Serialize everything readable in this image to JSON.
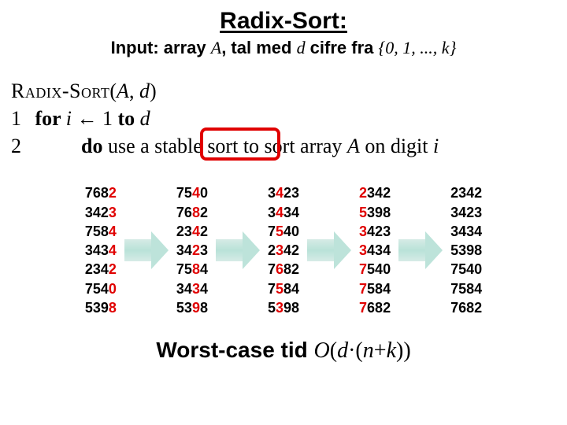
{
  "title": "Radix-Sort:",
  "subtitle": {
    "prefix": "Input: array ",
    "A": "A",
    "mid": ", tal med ",
    "d": "d",
    "suffix": " cifre fra ",
    "set": "{0, 1, ..., k}"
  },
  "pseudocode": {
    "head": {
      "name": "Radix-Sort",
      "args_open": "(",
      "A": "A",
      "comma": ", ",
      "d": "d",
      "args_close": ")"
    },
    "line1": {
      "num": "1",
      "for": "for ",
      "i": "i",
      "arrow": " ← 1 ",
      "to": "to ",
      "d": "d"
    },
    "line2": {
      "num": "2",
      "do": "do ",
      "rest1": "use a stable sort to sort array ",
      "A": "A",
      "rest2": " on digit ",
      "i": "i"
    }
  },
  "passes": [
    {
      "rows": [
        [
          [
            "768",
            "2"
          ]
        ],
        [
          [
            "342",
            "3"
          ]
        ],
        [
          [
            "758",
            "4"
          ]
        ],
        [
          [
            "343",
            "4"
          ]
        ],
        [
          [
            "234",
            "2"
          ]
        ],
        [
          [
            "754",
            "0"
          ]
        ],
        [
          [
            "539",
            "8"
          ]
        ]
      ]
    },
    {
      "rows": [
        [
          [
            "75",
            "4",
            "0"
          ]
        ],
        [
          [
            "76",
            "8",
            "2"
          ]
        ],
        [
          [
            "23",
            "4",
            "2"
          ]
        ],
        [
          [
            "34",
            "2",
            "3"
          ]
        ],
        [
          [
            "75",
            "8",
            "4"
          ]
        ],
        [
          [
            "34",
            "3",
            "4"
          ]
        ],
        [
          [
            "53",
            "9",
            "8"
          ]
        ]
      ]
    },
    {
      "rows": [
        [
          [
            "3",
            "4",
            "23"
          ]
        ],
        [
          [
            "3",
            "4",
            "34"
          ]
        ],
        [
          [
            "7",
            "5",
            "40"
          ]
        ],
        [
          [
            "2",
            "3",
            "42"
          ]
        ],
        [
          [
            "7",
            "6",
            "82"
          ]
        ],
        [
          [
            "7",
            "5",
            "84"
          ]
        ],
        [
          [
            "5",
            "3",
            "98"
          ]
        ]
      ]
    },
    {
      "rows": [
        [
          [
            "2",
            "342"
          ]
        ],
        [
          [
            "5",
            "398"
          ]
        ],
        [
          [
            "3",
            "423"
          ]
        ],
        [
          [
            "3",
            "434"
          ]
        ],
        [
          [
            "7",
            "540"
          ]
        ],
        [
          [
            "7",
            "584"
          ]
        ],
        [
          [
            "7",
            "682"
          ]
        ]
      ]
    },
    {
      "rows": [
        [
          [
            "2342"
          ]
        ],
        [
          [
            "3423"
          ]
        ],
        [
          [
            "3434"
          ]
        ],
        [
          [
            "5398"
          ]
        ],
        [
          [
            "7540"
          ]
        ],
        [
          [
            "7584"
          ]
        ],
        [
          [
            "7682"
          ]
        ]
      ]
    }
  ],
  "complexity": {
    "label": "Worst-case tid ",
    "expr": {
      "O": "O",
      "open": "(",
      "d": "d",
      "dot": "·(",
      "n": "n",
      "plus": "+",
      "k": "k",
      "close": "))"
    }
  }
}
